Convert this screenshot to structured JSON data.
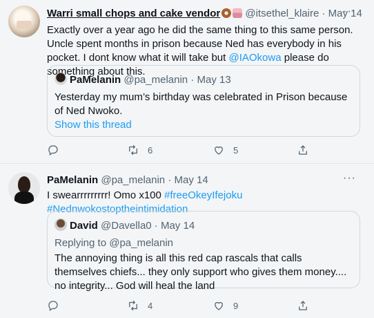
{
  "tweets": [
    {
      "author_name": "Warri small chops and cake vendor",
      "author_emojis": [
        "donut-icon",
        "cake-icon"
      ],
      "handle": "@itsethel_klaire",
      "dot": "·",
      "date": "May 14",
      "more": "···",
      "text_before_link": "Exactly over a year ago he did the same thing to this same person. Uncle spent months in prison because Ned has everybody in his pocket.  I dont know what it will take but ",
      "mention": "@IAOkowa",
      "text_after_link": " please do something about this.",
      "quote": {
        "author_name": "PaMelanin",
        "handle": "@pa_melanin",
        "dot": "·",
        "date": "May 13",
        "text": "Yesterday my mum’s birthday was celebrated in Prison because of Ned Nwoko.",
        "show_thread": "Show this thread"
      },
      "actions": {
        "reply": "",
        "retweet": "6",
        "like": "5",
        "share": ""
      }
    },
    {
      "author_name": "PaMelanin",
      "handle": "@pa_melanin",
      "dot": "·",
      "date": "May 14",
      "more": "···",
      "text_before_link": "I swearrrrrrrrr! Omo x100 ",
      "hashtag1": "#freeOkeyIfejoku",
      "hashtag2": "#Nednwokostoptheintimidation",
      "quote": {
        "author_name": "David",
        "handle": "@Davella0",
        "dot": "·",
        "date": "May 14",
        "replying_to": "Replying to ",
        "replying_handle": "@pa_melanin",
        "text": "The annoying thing is all this red cap rascals that calls themselves chiefs... they only support who gives them money.... no integrity... God will heal the land"
      },
      "actions": {
        "reply": "",
        "retweet": "4",
        "like": "9",
        "share": ""
      }
    }
  ],
  "colors": {
    "link": "#1d9bf0",
    "secondary": "#536471",
    "background": "#f3f5f7"
  }
}
